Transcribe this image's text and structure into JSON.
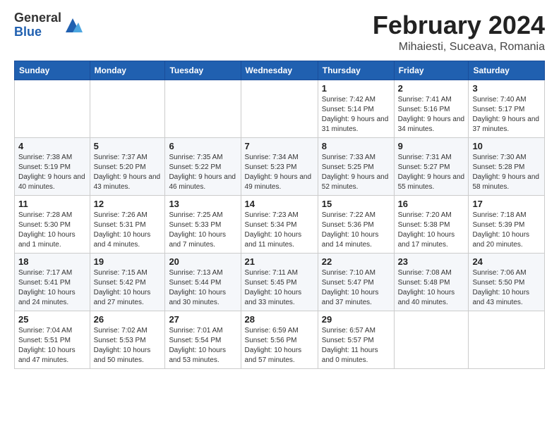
{
  "header": {
    "logo_text_general": "General",
    "logo_text_blue": "Blue",
    "month_title": "February 2024",
    "location": "Mihaiesti, Suceava, Romania"
  },
  "weekdays": [
    "Sunday",
    "Monday",
    "Tuesday",
    "Wednesday",
    "Thursday",
    "Friday",
    "Saturday"
  ],
  "weeks": [
    [
      {
        "day": "",
        "sunrise": "",
        "sunset": "",
        "daylight": ""
      },
      {
        "day": "",
        "sunrise": "",
        "sunset": "",
        "daylight": ""
      },
      {
        "day": "",
        "sunrise": "",
        "sunset": "",
        "daylight": ""
      },
      {
        "day": "",
        "sunrise": "",
        "sunset": "",
        "daylight": ""
      },
      {
        "day": "1",
        "sunrise": "Sunrise: 7:42 AM",
        "sunset": "Sunset: 5:14 PM",
        "daylight": "Daylight: 9 hours and 31 minutes."
      },
      {
        "day": "2",
        "sunrise": "Sunrise: 7:41 AM",
        "sunset": "Sunset: 5:16 PM",
        "daylight": "Daylight: 9 hours and 34 minutes."
      },
      {
        "day": "3",
        "sunrise": "Sunrise: 7:40 AM",
        "sunset": "Sunset: 5:17 PM",
        "daylight": "Daylight: 9 hours and 37 minutes."
      }
    ],
    [
      {
        "day": "4",
        "sunrise": "Sunrise: 7:38 AM",
        "sunset": "Sunset: 5:19 PM",
        "daylight": "Daylight: 9 hours and 40 minutes."
      },
      {
        "day": "5",
        "sunrise": "Sunrise: 7:37 AM",
        "sunset": "Sunset: 5:20 PM",
        "daylight": "Daylight: 9 hours and 43 minutes."
      },
      {
        "day": "6",
        "sunrise": "Sunrise: 7:35 AM",
        "sunset": "Sunset: 5:22 PM",
        "daylight": "Daylight: 9 hours and 46 minutes."
      },
      {
        "day": "7",
        "sunrise": "Sunrise: 7:34 AM",
        "sunset": "Sunset: 5:23 PM",
        "daylight": "Daylight: 9 hours and 49 minutes."
      },
      {
        "day": "8",
        "sunrise": "Sunrise: 7:33 AM",
        "sunset": "Sunset: 5:25 PM",
        "daylight": "Daylight: 9 hours and 52 minutes."
      },
      {
        "day": "9",
        "sunrise": "Sunrise: 7:31 AM",
        "sunset": "Sunset: 5:27 PM",
        "daylight": "Daylight: 9 hours and 55 minutes."
      },
      {
        "day": "10",
        "sunrise": "Sunrise: 7:30 AM",
        "sunset": "Sunset: 5:28 PM",
        "daylight": "Daylight: 9 hours and 58 minutes."
      }
    ],
    [
      {
        "day": "11",
        "sunrise": "Sunrise: 7:28 AM",
        "sunset": "Sunset: 5:30 PM",
        "daylight": "Daylight: 10 hours and 1 minute."
      },
      {
        "day": "12",
        "sunrise": "Sunrise: 7:26 AM",
        "sunset": "Sunset: 5:31 PM",
        "daylight": "Daylight: 10 hours and 4 minutes."
      },
      {
        "day": "13",
        "sunrise": "Sunrise: 7:25 AM",
        "sunset": "Sunset: 5:33 PM",
        "daylight": "Daylight: 10 hours and 7 minutes."
      },
      {
        "day": "14",
        "sunrise": "Sunrise: 7:23 AM",
        "sunset": "Sunset: 5:34 PM",
        "daylight": "Daylight: 10 hours and 11 minutes."
      },
      {
        "day": "15",
        "sunrise": "Sunrise: 7:22 AM",
        "sunset": "Sunset: 5:36 PM",
        "daylight": "Daylight: 10 hours and 14 minutes."
      },
      {
        "day": "16",
        "sunrise": "Sunrise: 7:20 AM",
        "sunset": "Sunset: 5:38 PM",
        "daylight": "Daylight: 10 hours and 17 minutes."
      },
      {
        "day": "17",
        "sunrise": "Sunrise: 7:18 AM",
        "sunset": "Sunset: 5:39 PM",
        "daylight": "Daylight: 10 hours and 20 minutes."
      }
    ],
    [
      {
        "day": "18",
        "sunrise": "Sunrise: 7:17 AM",
        "sunset": "Sunset: 5:41 PM",
        "daylight": "Daylight: 10 hours and 24 minutes."
      },
      {
        "day": "19",
        "sunrise": "Sunrise: 7:15 AM",
        "sunset": "Sunset: 5:42 PM",
        "daylight": "Daylight: 10 hours and 27 minutes."
      },
      {
        "day": "20",
        "sunrise": "Sunrise: 7:13 AM",
        "sunset": "Sunset: 5:44 PM",
        "daylight": "Daylight: 10 hours and 30 minutes."
      },
      {
        "day": "21",
        "sunrise": "Sunrise: 7:11 AM",
        "sunset": "Sunset: 5:45 PM",
        "daylight": "Daylight: 10 hours and 33 minutes."
      },
      {
        "day": "22",
        "sunrise": "Sunrise: 7:10 AM",
        "sunset": "Sunset: 5:47 PM",
        "daylight": "Daylight: 10 hours and 37 minutes."
      },
      {
        "day": "23",
        "sunrise": "Sunrise: 7:08 AM",
        "sunset": "Sunset: 5:48 PM",
        "daylight": "Daylight: 10 hours and 40 minutes."
      },
      {
        "day": "24",
        "sunrise": "Sunrise: 7:06 AM",
        "sunset": "Sunset: 5:50 PM",
        "daylight": "Daylight: 10 hours and 43 minutes."
      }
    ],
    [
      {
        "day": "25",
        "sunrise": "Sunrise: 7:04 AM",
        "sunset": "Sunset: 5:51 PM",
        "daylight": "Daylight: 10 hours and 47 minutes."
      },
      {
        "day": "26",
        "sunrise": "Sunrise: 7:02 AM",
        "sunset": "Sunset: 5:53 PM",
        "daylight": "Daylight: 10 hours and 50 minutes."
      },
      {
        "day": "27",
        "sunrise": "Sunrise: 7:01 AM",
        "sunset": "Sunset: 5:54 PM",
        "daylight": "Daylight: 10 hours and 53 minutes."
      },
      {
        "day": "28",
        "sunrise": "Sunrise: 6:59 AM",
        "sunset": "Sunset: 5:56 PM",
        "daylight": "Daylight: 10 hours and 57 minutes."
      },
      {
        "day": "29",
        "sunrise": "Sunrise: 6:57 AM",
        "sunset": "Sunset: 5:57 PM",
        "daylight": "Daylight: 11 hours and 0 minutes."
      },
      {
        "day": "",
        "sunrise": "",
        "sunset": "",
        "daylight": ""
      },
      {
        "day": "",
        "sunrise": "",
        "sunset": "",
        "daylight": ""
      }
    ]
  ]
}
